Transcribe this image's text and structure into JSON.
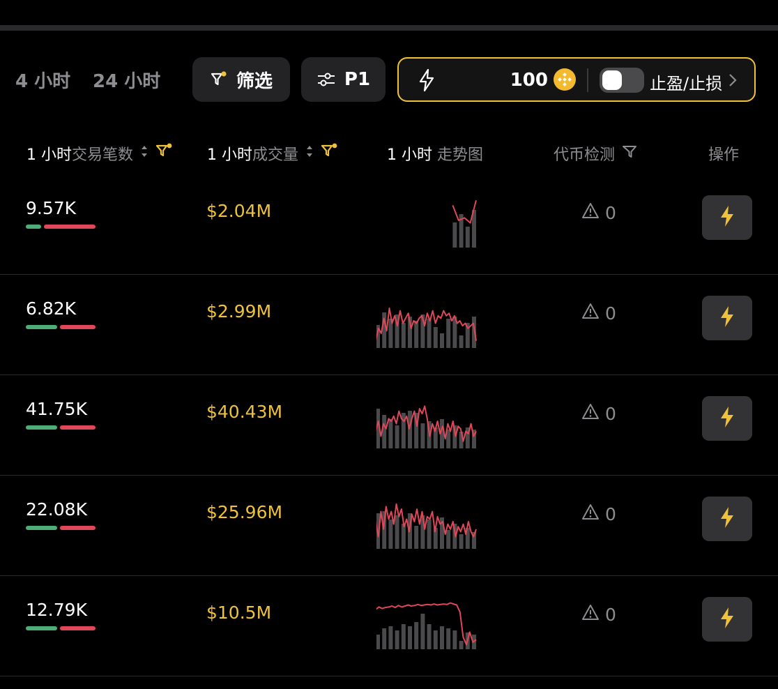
{
  "tabs": [
    "4 小时",
    "24 小时"
  ],
  "toolbar": {
    "filter_label": "筛选",
    "preset_label": "P1",
    "quick_buy_amount": "100",
    "tpsl_label": "止盈/止损",
    "tpsl_enabled": false,
    "accent_color": "#f0c23a"
  },
  "headers": {
    "tx_prefix": "1 小时",
    "tx_suffix": "交易笔数",
    "vol_prefix": "1 小时",
    "vol_suffix": "成交量",
    "trend_prefix": "1 小时",
    "trend_suffix": " 走势图",
    "check": "代币检测",
    "action": "操作"
  },
  "rows": [
    {
      "txs": "9.57K",
      "buy_ratio": 0.24,
      "volume": "$2.04M",
      "warnings": "0",
      "trend": [
        0.8,
        0.5,
        0.55,
        0.45,
        0.9
      ],
      "bars": [
        0.6,
        0.8,
        0.5,
        0.9
      ]
    },
    {
      "txs": "6.82K",
      "buy_ratio": 0.47,
      "volume": "$2.99M",
      "warnings": "0",
      "trend": [
        0.1,
        0.35,
        0.25,
        0.55,
        0.3,
        0.75,
        0.45,
        0.6,
        0.4,
        0.7,
        0.45,
        0.55,
        0.65,
        0.35,
        0.5,
        0.45,
        0.55,
        0.6,
        0.4,
        0.65,
        0.5,
        0.7,
        0.45,
        0.6,
        0.55,
        0.7,
        0.6,
        0.65,
        0.5,
        0.6,
        0.45,
        0.5,
        0.4,
        0.45,
        0.35,
        0.4,
        0.45,
        0.1
      ],
      "bars": [
        0.55,
        0.85,
        0.7,
        0.8,
        0.6,
        0.75,
        0.65,
        0.8,
        0.7,
        0.5,
        0.35,
        0.7,
        0.75,
        0.3,
        0.6,
        0.75
      ]
    },
    {
      "txs": "41.75K",
      "buy_ratio": 0.47,
      "volume": "$40.43M",
      "warnings": "0",
      "trend": [
        0.3,
        0.5,
        0.2,
        0.45,
        0.35,
        0.55,
        0.5,
        0.6,
        0.45,
        0.7,
        0.55,
        0.5,
        0.6,
        0.35,
        0.55,
        0.7,
        0.4,
        0.75,
        0.65,
        0.8,
        0.55,
        0.2,
        0.45,
        0.3,
        0.5,
        0.25,
        0.4,
        0.15,
        0.45,
        0.3,
        0.5,
        0.2,
        0.4,
        0.35,
        0.1,
        0.3,
        0.25,
        0.45,
        0.2,
        0.3
      ],
      "bars": [
        0.95,
        0.8,
        0.7,
        0.55,
        0.85,
        0.9,
        0.85,
        0.6,
        0.65,
        0.5,
        0.7,
        0.45,
        0.55,
        0.4,
        0.5,
        0.45
      ]
    },
    {
      "txs": "22.08K",
      "buy_ratio": 0.47,
      "volume": "$25.96M",
      "warnings": "0",
      "trend": [
        0.5,
        0.2,
        0.7,
        0.35,
        0.8,
        0.55,
        0.7,
        0.45,
        0.85,
        0.6,
        0.75,
        0.4,
        0.55,
        0.3,
        0.65,
        0.5,
        0.75,
        0.45,
        0.7,
        0.35,
        0.6,
        0.55,
        0.7,
        0.3,
        0.6,
        0.45,
        0.5,
        0.25,
        0.45,
        0.35,
        0.5,
        0.2,
        0.4,
        0.3,
        0.45,
        0.25,
        0.5,
        0.3,
        0.2,
        0.35
      ],
      "bars": [
        0.85,
        0.9,
        0.7,
        0.8,
        0.6,
        0.85,
        0.55,
        0.8,
        0.7,
        0.5,
        0.75,
        0.45,
        0.6,
        0.35,
        0.5,
        0.4
      ]
    },
    {
      "txs": "12.79K",
      "buy_ratio": 0.47,
      "volume": "$10.5M",
      "warnings": "0",
      "trend": [
        0.75,
        0.8,
        0.77,
        0.79,
        0.8,
        0.82,
        0.79,
        0.83,
        0.8,
        0.82,
        0.84,
        0.82,
        0.83,
        0.85,
        0.83,
        0.84,
        0.85,
        0.84,
        0.86,
        0.84,
        0.85,
        0.86,
        0.85,
        0.88,
        0.86,
        0.84,
        0.7,
        0.2,
        0.05,
        0.3,
        0.1,
        0.15
      ],
      "bars": [
        0.35,
        0.5,
        0.55,
        0.45,
        0.6,
        0.55,
        0.65,
        0.85,
        0.6,
        0.45,
        0.55,
        0.5,
        0.45,
        0.2,
        0.4,
        0.35
      ]
    }
  ]
}
